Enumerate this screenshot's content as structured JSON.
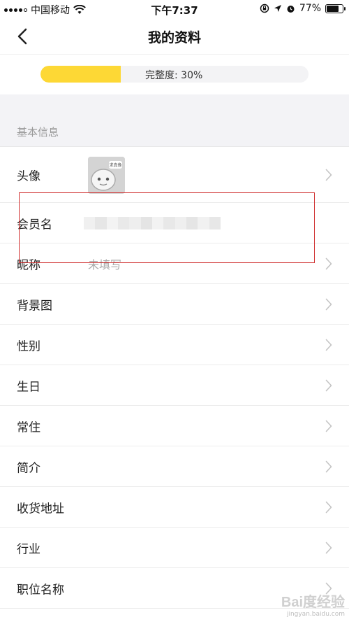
{
  "status_bar": {
    "carrier": "中国移动",
    "time": "下午7:37",
    "battery": "77%",
    "battery_level": 0.77,
    "icons": [
      "signal-icon",
      "wifi-icon",
      "orientation-lock-icon",
      "location-icon",
      "alarm-icon",
      "battery-icon"
    ]
  },
  "nav": {
    "title": "我的资料",
    "back_icon": "chevron-left-icon"
  },
  "completeness": {
    "label": "完整度: 30%",
    "fraction": 0.3,
    "bar_color": "#fdd835"
  },
  "section": {
    "title": "基本信息"
  },
  "rows": [
    {
      "label": "头像",
      "value": "",
      "has_avatar": true,
      "has_chevron": true
    },
    {
      "label": "会员名",
      "value": "",
      "blurred": true,
      "has_chevron": false
    },
    {
      "label": "昵称",
      "value": "未填写",
      "has_chevron": true
    },
    {
      "label": "背景图",
      "value": "",
      "has_chevron": true
    },
    {
      "label": "性别",
      "value": "",
      "has_chevron": true
    },
    {
      "label": "生日",
      "value": "",
      "has_chevron": true
    },
    {
      "label": "常住",
      "value": "",
      "has_chevron": true
    },
    {
      "label": "简介",
      "value": "",
      "has_chevron": true
    },
    {
      "label": "收货地址",
      "value": "",
      "has_chevron": true
    },
    {
      "label": "行业",
      "value": "",
      "has_chevron": true
    },
    {
      "label": "职位名称",
      "value": "",
      "has_chevron": true
    }
  ],
  "avatar_badge": "求真像",
  "watermark": {
    "main": "Bai度经验",
    "sub": "jingyan.baidu.com"
  },
  "colors": {
    "accent": "#fdd835",
    "highlight": "#d03030",
    "section_bg": "#f3f3f6"
  }
}
